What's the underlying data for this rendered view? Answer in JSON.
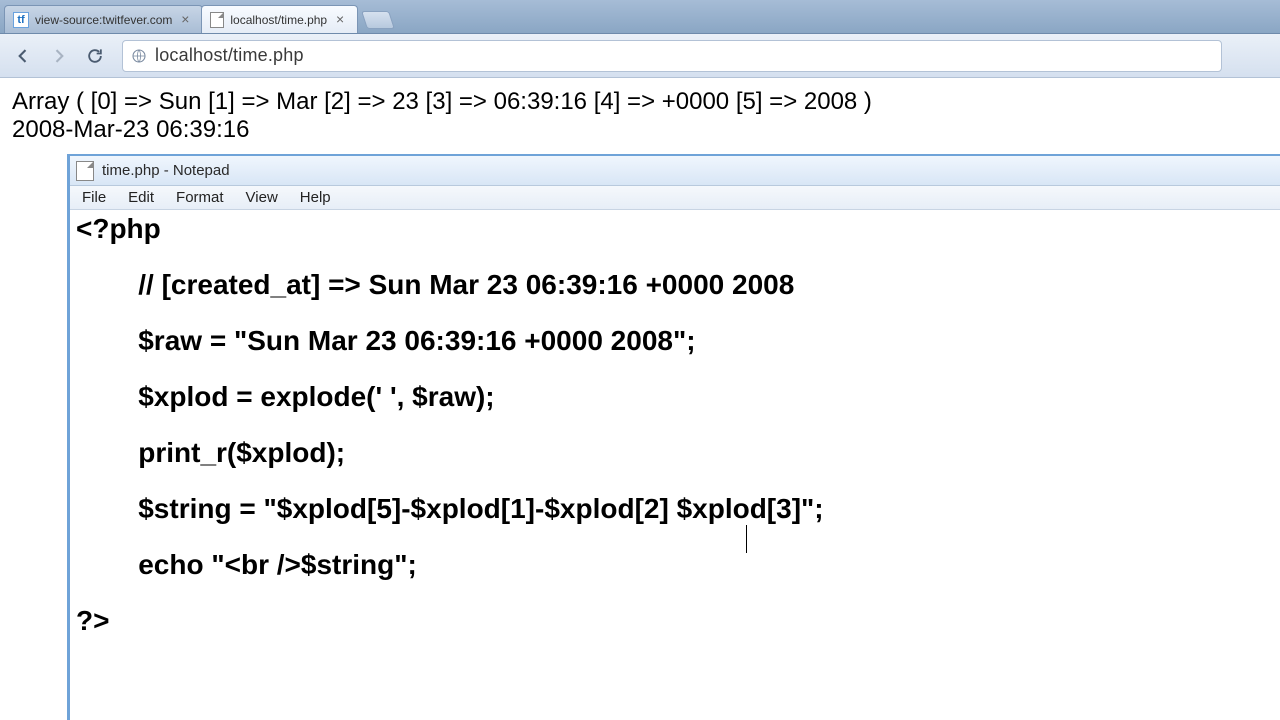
{
  "tabs": {
    "t0": {
      "title": "view-source:twitfever.com"
    },
    "t1": {
      "title": "localhost/time.php"
    }
  },
  "omnibox": {
    "url": "localhost/time.php"
  },
  "page": {
    "line1": "Array ( [0] => Sun [1] => Mar [2] => 23 [3] => 06:39:16 [4] => +0000 [5] => 2008 )",
    "line2": "2008-Mar-23 06:39:16"
  },
  "notepad": {
    "title": "time.php - Notepad",
    "menu": {
      "m0": "File",
      "m1": "Edit",
      "m2": "Format",
      "m3": "View",
      "m4": "Help"
    },
    "code": {
      "l0": "<?php",
      "l1": "        // [created_at] => Sun Mar 23 06:39:16 +0000 2008",
      "l2": "        $raw = \"Sun Mar 23 06:39:16 +0000 2008\";",
      "l3": "        $xplod = explode(' ', $raw);",
      "l4": "        print_r($xplod);",
      "l5": "        $string = \"$xplod[5]-$xplod[1]-$xplod[2] $xplod[3]\";",
      "l6": "        echo \"<br />$string\";",
      "l7": "?>"
    }
  }
}
